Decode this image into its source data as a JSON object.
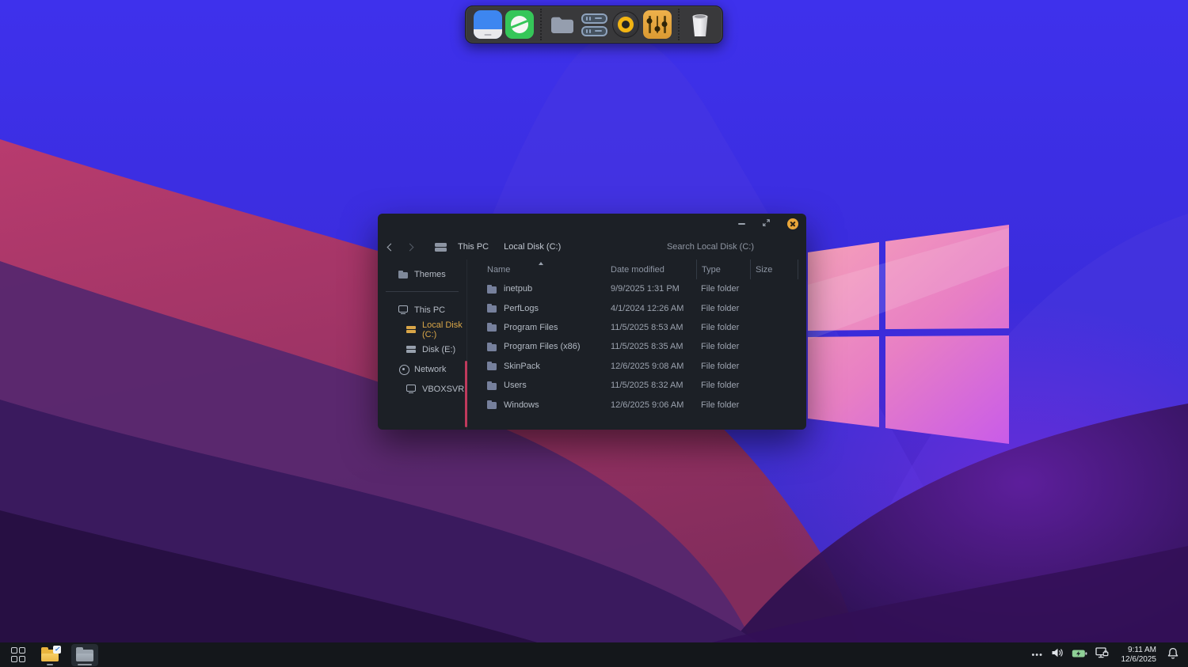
{
  "accent_colors": {
    "selection_amber": "#d9a648",
    "scrollbar_red": "#bf3a5c",
    "close_button": "#e9a63a",
    "dock_mixer_orange": "#e5a53e",
    "browser_green": "#35c659",
    "disk_blue": "#3d86f0"
  },
  "dock": {
    "icons": [
      "disk-icon",
      "browser-icon",
      "folder-icon",
      "servers-icon",
      "speaker-icon",
      "equalizer-icon",
      "trash-icon"
    ]
  },
  "explorer": {
    "titlebar": {
      "controls": [
        "minimize",
        "maximize",
        "close"
      ]
    },
    "nav": {
      "breadcrumb": [
        {
          "label": "This PC"
        },
        {
          "label": "Local Disk (C:)"
        }
      ],
      "search": "Search Local Disk (C:)"
    },
    "sidebar": {
      "top": [
        {
          "label": "Themes",
          "icon": "folder"
        }
      ],
      "items": [
        {
          "label": "This PC",
          "icon": "monitor"
        },
        {
          "label": "Local Disk (C:)",
          "icon": "drive",
          "selected": true,
          "indent": true
        },
        {
          "label": "Disk (E:)",
          "icon": "drive",
          "indent": true
        },
        {
          "label": "Network",
          "icon": "network"
        },
        {
          "label": "VBOXSVR",
          "icon": "monitor",
          "indent": true
        }
      ]
    },
    "columns": {
      "name": "Name",
      "date": "Date modified",
      "type": "Type",
      "size": "Size"
    },
    "files": [
      {
        "name": "inetpub",
        "date": "9/9/2025 1:31 PM",
        "type": "File folder",
        "size": ""
      },
      {
        "name": "PerfLogs",
        "date": "4/1/2024 12:26 AM",
        "type": "File folder",
        "size": ""
      },
      {
        "name": "Program Files",
        "date": "11/5/2025 8:53 AM",
        "type": "File folder",
        "size": ""
      },
      {
        "name": "Program Files (x86)",
        "date": "11/5/2025 8:35 AM",
        "type": "File folder",
        "size": ""
      },
      {
        "name": "SkinPack",
        "date": "12/6/2025 9:08 AM",
        "type": "File folder",
        "size": ""
      },
      {
        "name": "Users",
        "date": "11/5/2025 8:32 AM",
        "type": "File folder",
        "size": ""
      },
      {
        "name": "Windows",
        "date": "12/6/2025 9:06 AM",
        "type": "File folder",
        "size": ""
      }
    ]
  },
  "taskbar": {
    "overflow": "•••",
    "tray_icons": [
      "volume-icon",
      "battery-icon",
      "network-icon",
      "notifications-icon"
    ],
    "clock": {
      "time": "9:11 AM",
      "date": "12/6/2025"
    }
  }
}
